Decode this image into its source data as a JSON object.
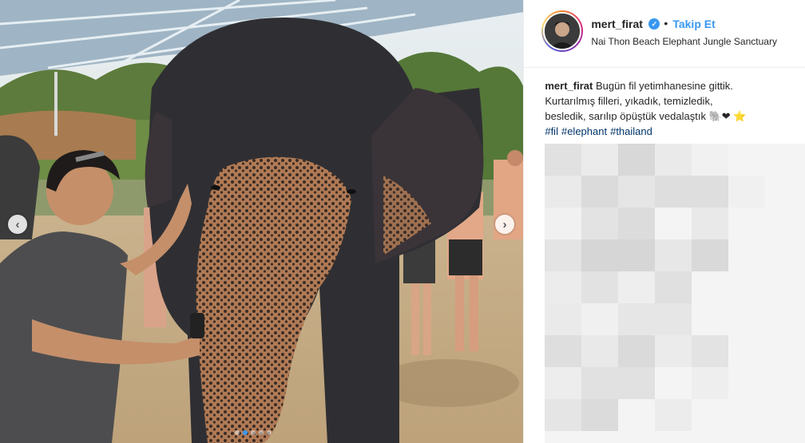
{
  "post": {
    "username": "mert_firat",
    "follow_label": "Takip Et",
    "separator": "•",
    "location": "Nai Thon Beach Elephant Jungle Sanctuary",
    "caption": {
      "username": "mert_firat",
      "lines": [
        "Bugün fil yetimhanesine gittik.",
        "Kurtarılmış filleri, yıkadık, temizledik,",
        "besledik, sarılıp öpüştük vedalaştık 🐘❤ ⭐"
      ],
      "hashtags": [
        "#fil",
        "#elephant",
        "#thailand"
      ]
    }
  },
  "carousel": {
    "prev_icon": "‹",
    "next_icon": "›",
    "slide_count": 5,
    "active_index": 1
  },
  "colors": {
    "link_blue": "#3897f0",
    "hashtag": "#003569",
    "text": "#262626"
  }
}
